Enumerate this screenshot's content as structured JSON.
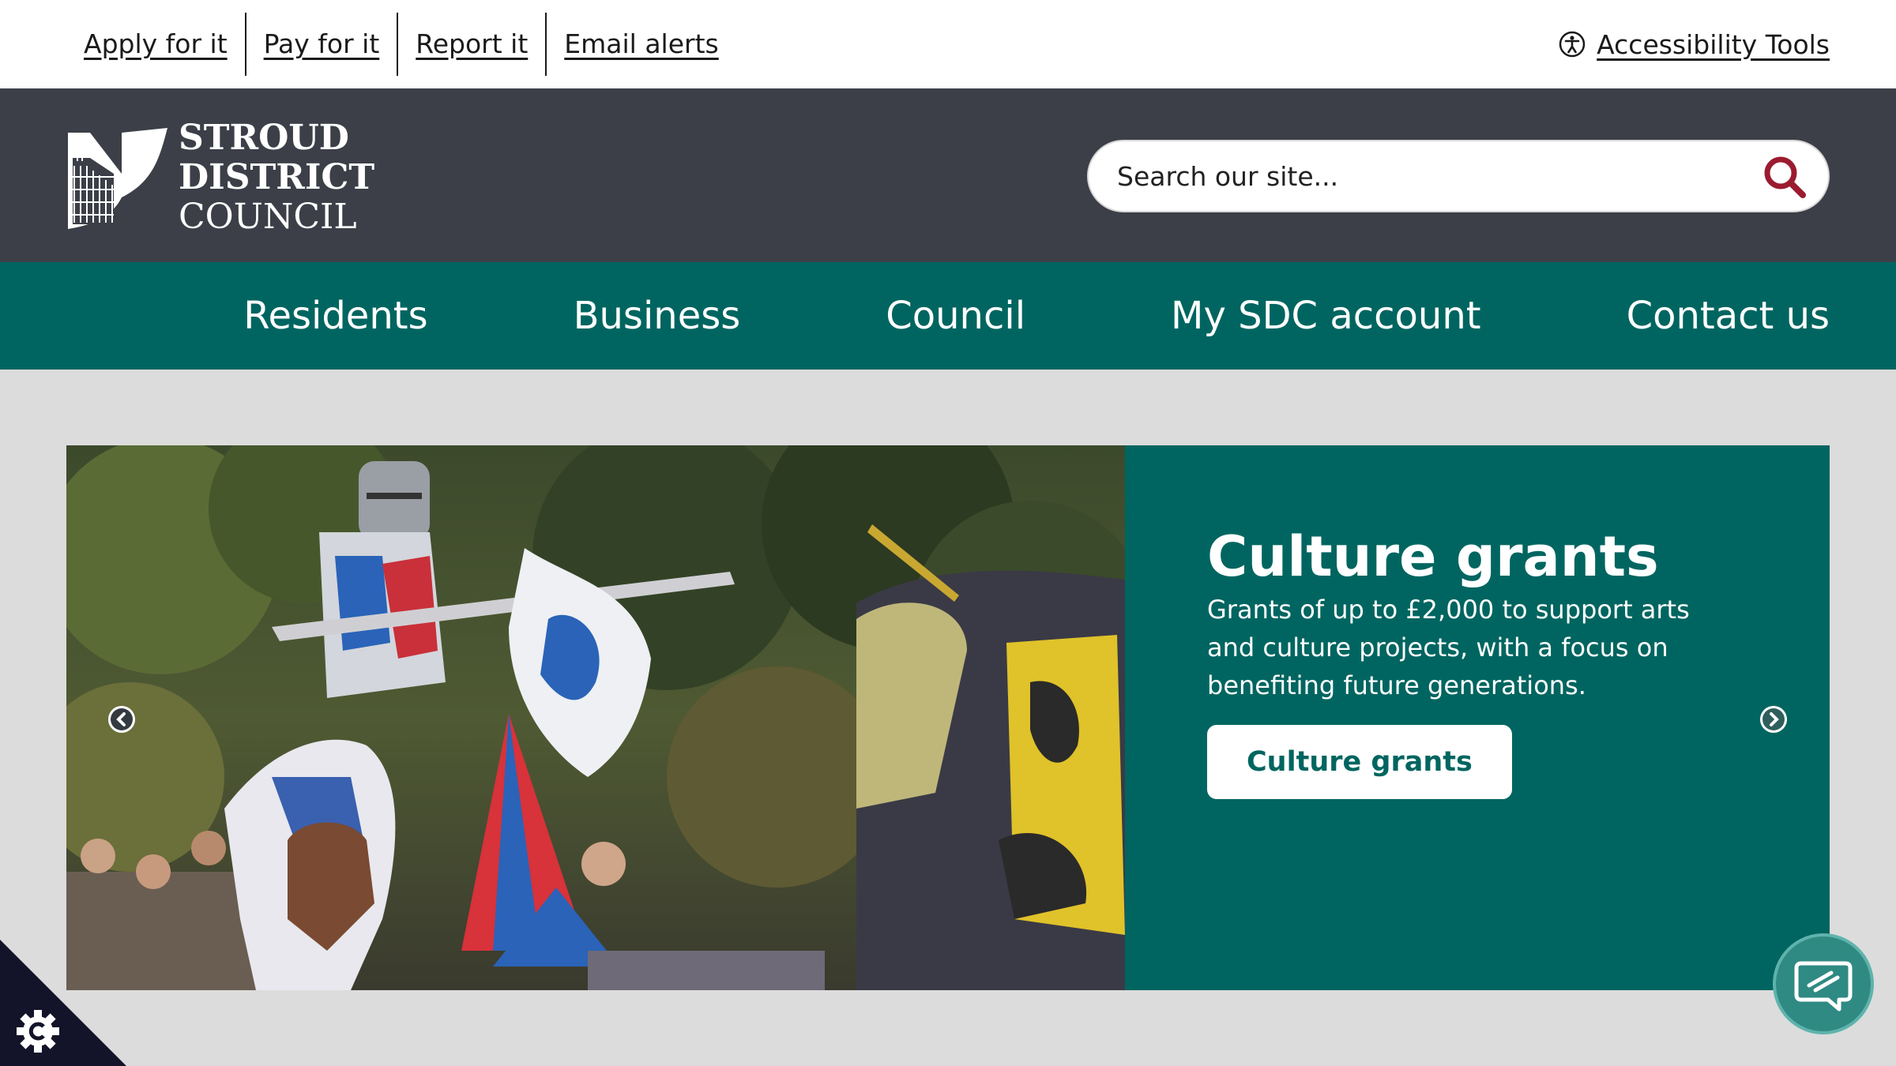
{
  "utility": {
    "links": [
      "Apply for it",
      "Pay for it",
      "Report it",
      "Email alerts"
    ],
    "accessibility_label": "Accessibility Tools"
  },
  "header": {
    "logo_lines": [
      "STROUD",
      "DISTRICT",
      "COUNCIL"
    ],
    "search_placeholder": "Search our site..."
  },
  "nav": {
    "items": [
      "Residents",
      "Business",
      "Council",
      "My SDC account",
      "Contact us"
    ]
  },
  "hero": {
    "title": "Culture grants",
    "description": "Grants of up to £2,000 to support arts and culture projects, with a focus on benefiting future generations.",
    "button_label": "Culture grants"
  },
  "colors": {
    "brand_teal": "#006560",
    "header_dark": "#3c3f48",
    "search_icon": "#9b1b30",
    "page_bg": "#dcdcdc"
  },
  "icons": {
    "accessibility": "accessibility-icon",
    "search": "search-icon",
    "prev": "chevron-left-icon",
    "next": "chevron-right-icon",
    "cookie": "cookie-settings-icon",
    "chat": "chat-icon"
  }
}
